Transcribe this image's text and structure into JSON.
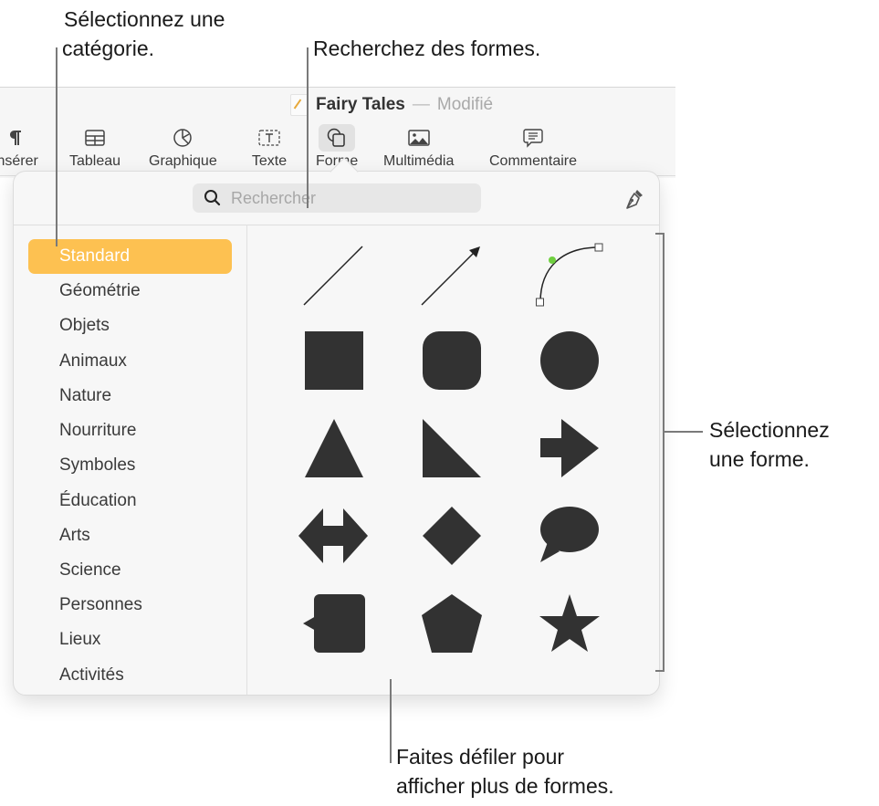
{
  "window": {
    "doc_title": "Fairy Tales",
    "separator": "—",
    "doc_status": "Modifié"
  },
  "toolbar": {
    "items": [
      {
        "label": "Insérer",
        "icon": "paragraph-icon"
      },
      {
        "label": "Tableau",
        "icon": "table-icon"
      },
      {
        "label": "Graphique",
        "icon": "chart-icon"
      },
      {
        "label": "Texte",
        "icon": "text-box-icon"
      },
      {
        "label": "Forme",
        "icon": "shape-icon",
        "active": true
      },
      {
        "label": "Multimédia",
        "icon": "media-icon"
      },
      {
        "label": "Commentaire",
        "icon": "comment-icon"
      }
    ]
  },
  "popover": {
    "search_placeholder": "Rechercher",
    "categories": [
      {
        "label": "Standard",
        "selected": true
      },
      {
        "label": "Géométrie"
      },
      {
        "label": "Objets"
      },
      {
        "label": "Animaux"
      },
      {
        "label": "Nature"
      },
      {
        "label": "Nourriture"
      },
      {
        "label": "Symboles"
      },
      {
        "label": "Éducation"
      },
      {
        "label": "Arts"
      },
      {
        "label": "Science"
      },
      {
        "label": "Personnes"
      },
      {
        "label": "Lieux"
      },
      {
        "label": "Activités"
      }
    ],
    "shapes": [
      "line",
      "arrow",
      "curve",
      "square",
      "rounded-square",
      "circle",
      "triangle",
      "right-triangle",
      "right-arrow",
      "double-arrow",
      "diamond",
      "speech-bubble",
      "callout-square",
      "pentagon",
      "star"
    ]
  },
  "callouts": {
    "category": [
      "Sélectionnez une",
      "catégorie."
    ],
    "search": "Recherchez des formes.",
    "shape": [
      "Sélectionnez",
      "une forme."
    ],
    "scroll": [
      "Faites défiler pour",
      "afficher plus de formes."
    ]
  },
  "colors": {
    "accent_selected": "#fdc151",
    "shape_fill": "#323232",
    "curve_handle": "#6fcf3f"
  }
}
